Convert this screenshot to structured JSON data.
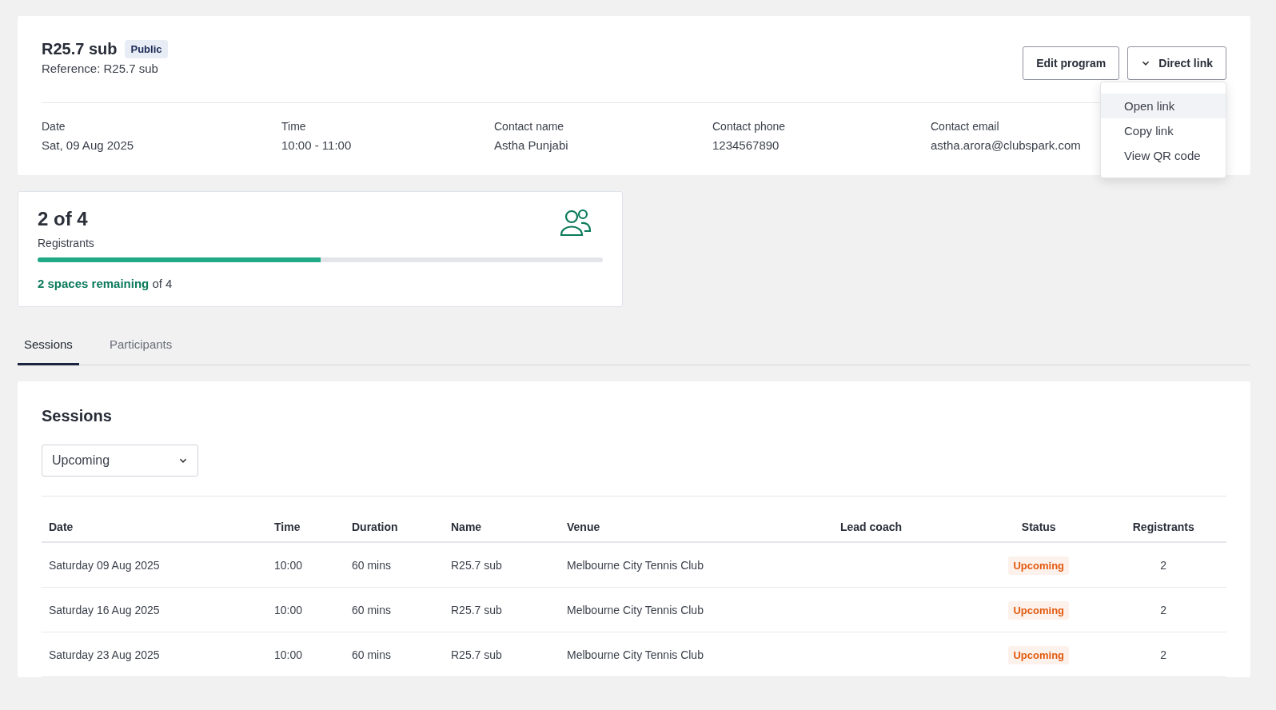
{
  "program": {
    "title": "R25.7 sub",
    "badge": "Public",
    "reference": "Reference: R25.7 sub",
    "actions": [
      {
        "kind": "plain",
        "label": "Edit program"
      },
      {
        "kind": "menu",
        "label": "Direct link",
        "expanded": true
      }
    ],
    "menu": [
      {
        "label": "Open link",
        "highlighted": true
      },
      {
        "label": "Copy link",
        "highlighted": false
      },
      {
        "label": "View QR code",
        "highlighted": false
      }
    ],
    "details": [
      {
        "label": "Date",
        "value": "Sat, 09 Aug 2025"
      },
      {
        "label": "Time",
        "value": "10:00 - 11:00"
      },
      {
        "label": "Contact name",
        "value": "Astha Punjabi"
      },
      {
        "label": "Contact phone",
        "value": "1234567890"
      },
      {
        "label": "Contact email",
        "value": "astha.arora@clubspark.com"
      }
    ]
  },
  "registrants": {
    "count": "2 of 4",
    "label": "Registrants",
    "level": 0.5,
    "remaining": "**2 spaces remaining** of 4"
  },
  "tabs": [
    {
      "label": "Sessions",
      "selected": true
    },
    {
      "label": "Participants",
      "selected": false
    }
  ],
  "sessions": {
    "title": "Sessions",
    "filter": "Upcoming",
    "columns": [
      "Date",
      "Time",
      "Duration",
      "Name",
      "Venue",
      "Lead coach",
      "Status",
      "Registrants"
    ],
    "rows": [
      {
        "date": "Saturday 09 Aug 2025",
        "time": "10:00",
        "duration": "60 mins",
        "name": "R25.7 sub",
        "venue": "Melbourne City Tennis Club",
        "status": "Upcoming",
        "registrants": "2"
      },
      {
        "date": "Saturday 16 Aug 2025",
        "time": "10:00",
        "duration": "60 mins",
        "name": "R25.7 sub",
        "venue": "Melbourne City Tennis Club",
        "status": "Upcoming",
        "registrants": "2"
      },
      {
        "date": "Saturday 23 Aug 2025",
        "time": "10:00",
        "duration": "60 mins",
        "name": "R25.7 sub",
        "venue": "Melbourne City Tennis Club",
        "status": "Upcoming",
        "registrants": "2"
      }
    ]
  }
}
